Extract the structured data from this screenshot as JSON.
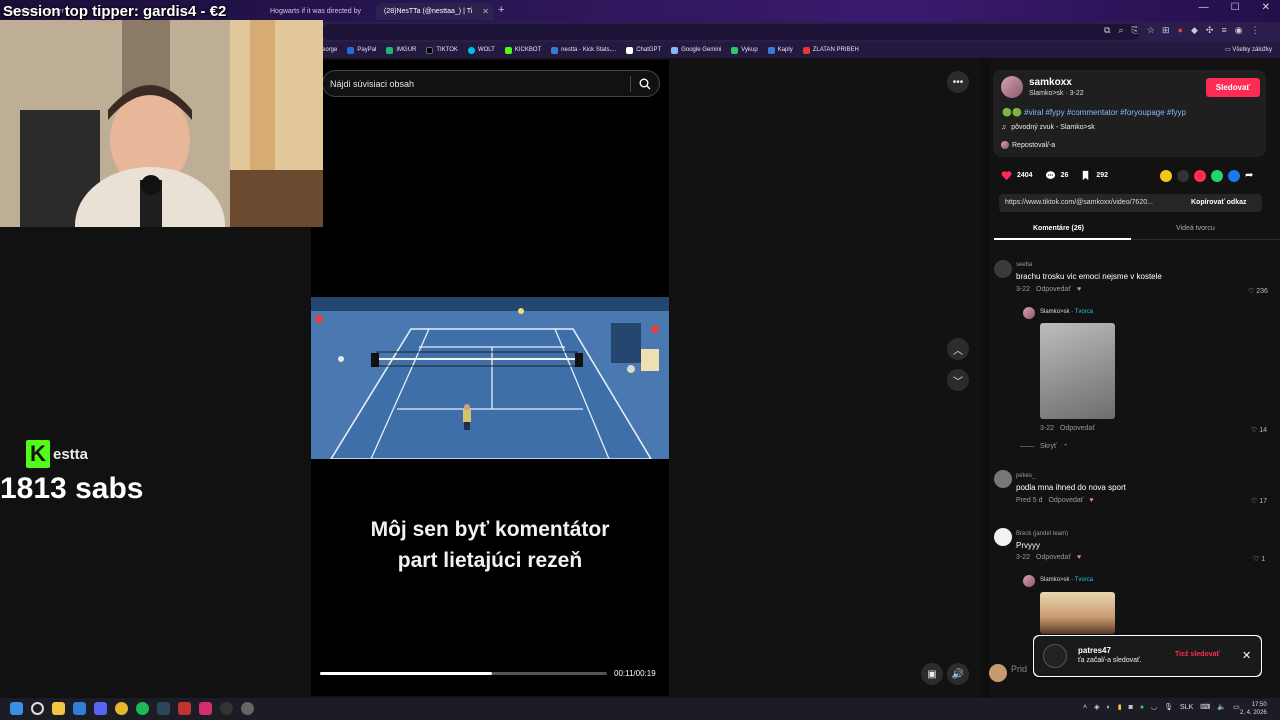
{
  "browser": {
    "tabs": [
      {
        "label": "Session top tipper",
        "active": false
      },
      {
        "label": "Hogwarts if it was directed by",
        "active": false
      },
      {
        "label": "(28)NesTTa (@nesttaa_) | Ti",
        "active": true
      }
    ],
    "new_tab": "+",
    "bookmarks": [
      {
        "label": "eorge",
        "color": "#888"
      },
      {
        "label": "PayPal",
        "color": "#1e6fd9"
      },
      {
        "label": "IMGUR",
        "color": "#1bb76e"
      },
      {
        "label": "TIKTOK",
        "color": "#111111"
      },
      {
        "label": "WOLT",
        "color": "#00c2e8"
      },
      {
        "label": "KICKBOT",
        "color": "#53fc18"
      },
      {
        "label": "nestta - Kick Stats,...",
        "color": "#3a7bd5"
      },
      {
        "label": "ChatGPT",
        "color": "#ffffff"
      },
      {
        "label": "Google Gemini",
        "color": "#8ab4f8"
      },
      {
        "label": "Vykup",
        "color": "#2ec866"
      },
      {
        "label": "Kaply",
        "color": "#3a7bd5"
      },
      {
        "label": "ZLATAN PRIBEH",
        "color": "#e53935"
      }
    ],
    "all_bookmarks": "Všetky záložky"
  },
  "overlay": {
    "session_text": "Session top tipper: gardis4 - €2",
    "kick_letter": "K",
    "kick_name": "estta",
    "subs_text": "1813 sabs"
  },
  "video": {
    "search_placeholder": "Nájdi súvisiaci obsah",
    "caption_line1": "Môj sen byť komentátor",
    "caption_line2": "part lietajúci rezeň",
    "time": "00:11/00:19",
    "progress_fraction": 0.6
  },
  "creator": {
    "name": "samkoxx",
    "sub": "Slamko>sk · 3-22",
    "follow": "Sledovať",
    "description": "🟢🟢 #viral #fypy #commentator #foryoupage #fyyp",
    "sound": "pôvodný zvuk - Slamko>sk",
    "sound_icon": "♫",
    "repost": "Repostoval/-a",
    "likes": "2404",
    "comments": "26",
    "saves": "292",
    "link": "https://www.tiktok.com/@samkoxx/video/7620...",
    "copy": "Kopírovať odkaz",
    "tab_comments": "Komentáre (26)",
    "tab_videos": "Videá tvorcu"
  },
  "comments": [
    {
      "user": "seeba",
      "text": "brachu trosku vic emoci nejsme v kostele",
      "date": "3-22",
      "reply": "Odpovedať",
      "likes": "236"
    },
    {
      "user": "Slamko>sk",
      "tag": "Tvorca",
      "date": "3-22",
      "reply": "Odpovedať",
      "likes": "14"
    },
    {
      "hide": "Skryť"
    },
    {
      "user": "pekes_",
      "text": "podla mna ihned do nova sport",
      "date": "Pred 5 d",
      "reply": "Odpovedať",
      "likes": "17"
    },
    {
      "user": "Breck (jandel team)",
      "text": "Prvyyy",
      "date": "3-22",
      "reply": "Odpovedať",
      "likes": "1"
    },
    {
      "user": "Slamko>sk",
      "tag": "Tvorca"
    }
  ],
  "notification": {
    "user": "patres47",
    "text": "ťa začal/-a sledovať.",
    "follow_back": "Tiež sledovať",
    "close": "✕"
  },
  "comment_input_placeholder": "Prid",
  "taskbar": {
    "lang": "SLK",
    "time": "17:50",
    "date": "2. 4. 2026"
  }
}
